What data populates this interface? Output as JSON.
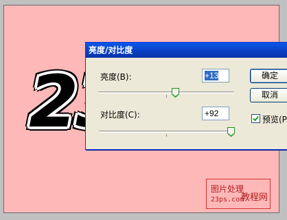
{
  "canvas": {
    "big_text": "23",
    "watermark": {
      "line1": "图片处理",
      "line2": "23ps.com",
      "line3": "教程网"
    }
  },
  "dialog": {
    "title": "亮度/对比度",
    "brightness": {
      "label": "亮度(B):",
      "value": "+13",
      "slider_fraction": 0.57
    },
    "contrast": {
      "label": "对比度(C):",
      "value": "+92",
      "slider_fraction": 0.98
    },
    "ok_label": "确定",
    "cancel_label": "取消",
    "preview": {
      "label": "预览(P)",
      "checked": true
    }
  },
  "colors": {
    "canvas_bg": "#ffb8b8",
    "titlebar": "#0a58e8",
    "dialog_bg": "#ece9d8",
    "watermark": "#b02020"
  }
}
